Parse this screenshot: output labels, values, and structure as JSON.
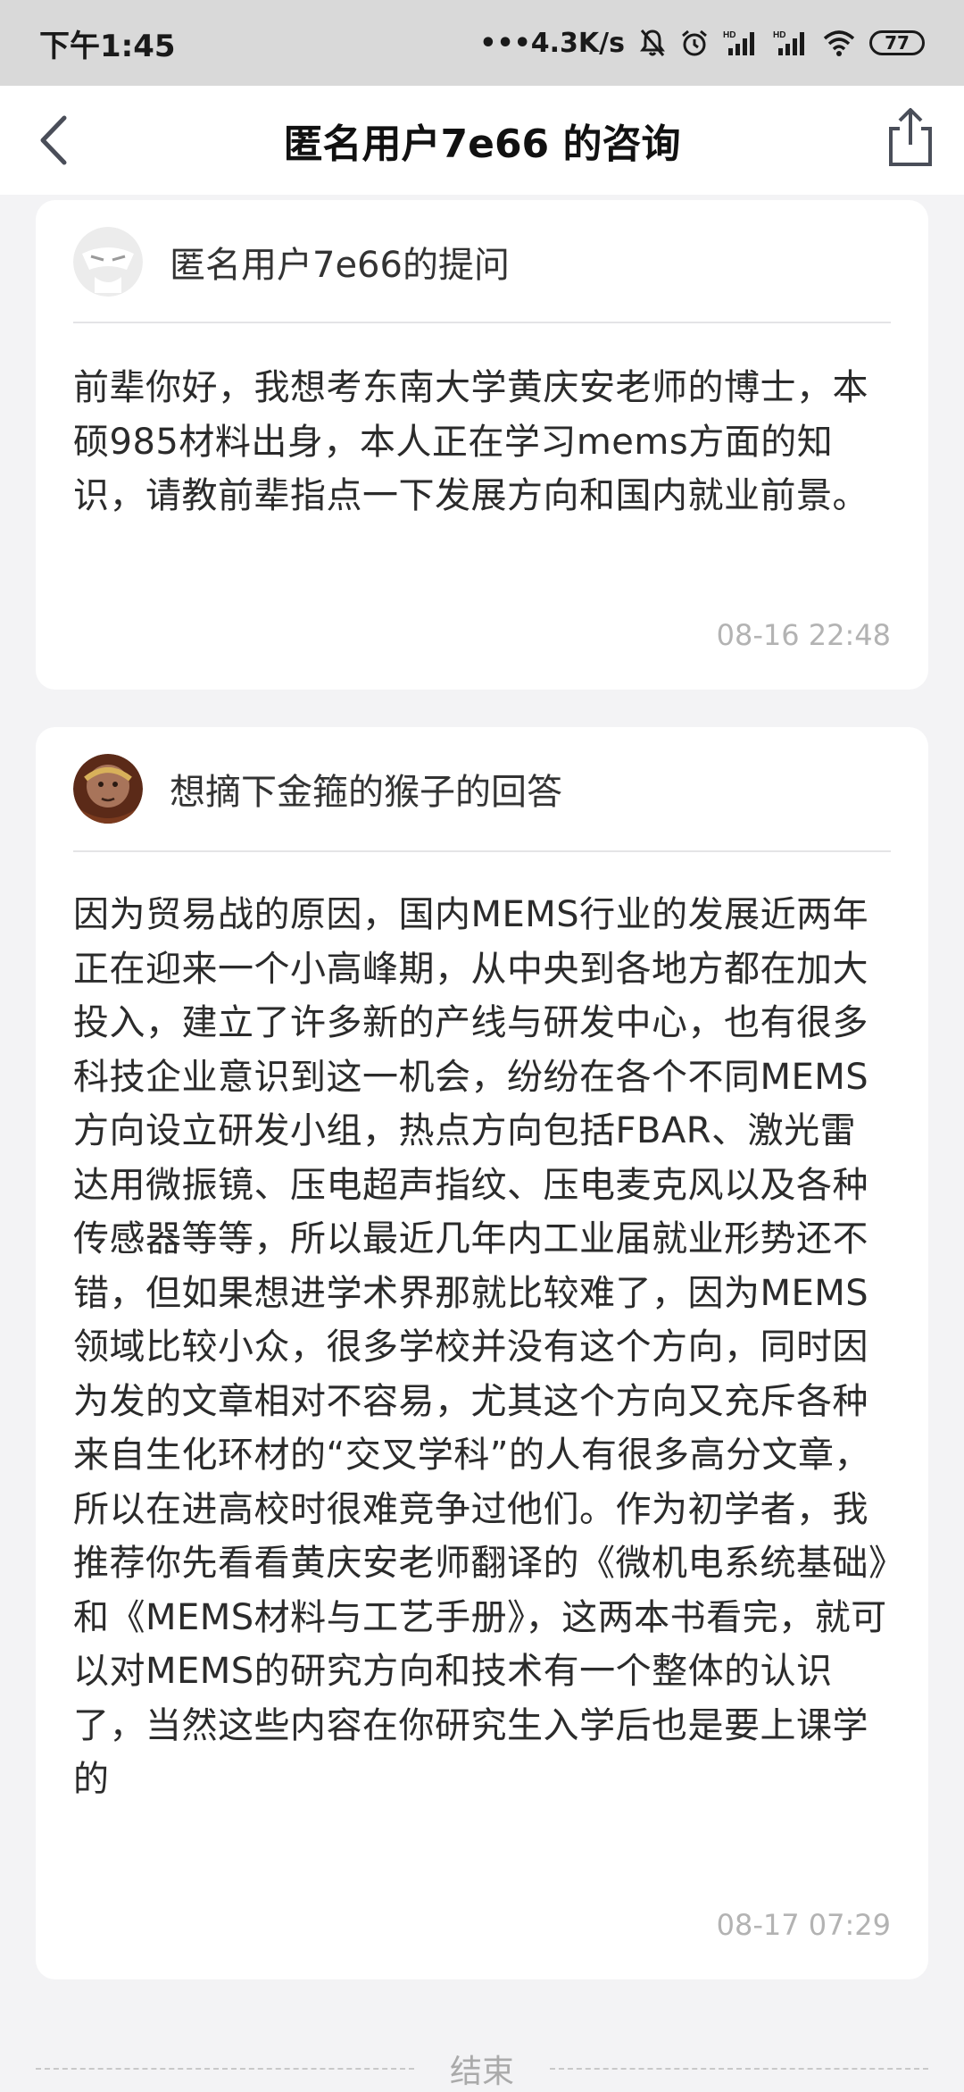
{
  "status_bar": {
    "time": "下午1:45",
    "network_speed": "•••4.3K/s",
    "battery_level": "77",
    "icons": [
      "mute-bell-icon",
      "alarm-icon",
      "signal-hd-icon",
      "signal-hd-icon",
      "wifi-icon",
      "battery-icon"
    ]
  },
  "nav": {
    "title": "匿名用户7e66 的咨询",
    "back_icon": "back-arrow-icon",
    "share_icon": "share-icon"
  },
  "question": {
    "header": "匿名用户7e66的提问",
    "text": "前辈你好，我想考东南大学黄庆安老师的博士，本硕985材料出身，本人正在学习mems方面的知识，请教前辈指点一下发展方向和国内就业前景。",
    "time": "08-16 22:48"
  },
  "answer": {
    "header": "想摘下金箍的猴子的回答",
    "text": "因为贸易战的原因，国内MEMS行业的发展近两年正在迎来一个小高峰期，从中央到各地方都在加大投入，建立了许多新的产线与研发中心，也有很多科技企业意识到这一机会，纷纷在各个不同MEMS方向设立研发小组，热点方向包括FBAR、激光雷达用微振镜、压电超声指纹、压电麦克风以及各种传感器等等，所以最近几年内工业届就业形势还不错，但如果想进学术界那就比较难了，因为MEMS领域比较小众，很多学校并没有这个方向，同时因为发的文章相对不容易，尤其这个方向又充斥各种来自生化环材的“交叉学科”的人有很多高分文章，所以在进高校时很难竞争过他们。作为初学者，我推荐你先看看黄庆安老师翻译的《微机电系统基础》和《MEMS材料与工艺手册》，这两本书看完，就可以对MEMS的研究方向和技术有一个整体的认识了，当然这些内容在你研究生入学后也是要上课学的",
    "time": "08-17 07:29"
  },
  "footer": {
    "end_label": "结束"
  }
}
